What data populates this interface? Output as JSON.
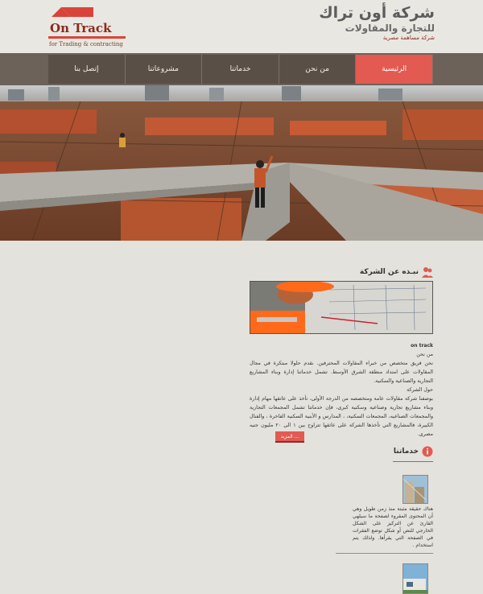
{
  "brand": {
    "logo_name": "On Track",
    "logo_tagline": "for Trading & contracting",
    "company_name": "شركة أون تراك",
    "company_sub": "للتجارة والمقاولات",
    "company_type": "شركة مساهمة مصرية",
    "colors": {
      "accent": "#e25a52",
      "nav_bg": "#5a4f47",
      "logo_red": "#8b2a1b"
    }
  },
  "nav": {
    "items": [
      {
        "label": "الرئيسية"
      },
      {
        "label": "من نحن"
      },
      {
        "label": "خدماتنا"
      },
      {
        "label": "مشروعاتنا"
      },
      {
        "label": "إتصل بنا"
      }
    ],
    "active_index": 0
  },
  "slider": {
    "slide_count": 4,
    "active_index": 1
  },
  "about": {
    "title": "نبـذه عن الشركة",
    "about_label_en": "on track",
    "about_label": "من نحن",
    "p1": "نحن فريق متخصص من خبراء المقاولات المحترفين. نقدم حلولا مبتكرة في مجال المقاولات على امتداد منطقة الشرق الأوسط. تشمل خدماتنا إدارة وبناء المشاريع التجارية والصناعية والسكنية.",
    "heading2": "حول الشركة",
    "p2": "بوصفنا شركة مقاولات عامة ومتخصصه من الدرجة الأولى، تأخذ على عاتقها مهام إدارة وبناء مشاريع تجارية وصناعية وسكنية كبرى، فإن خدماتنا تشمل المجمعات التجارية والمجمعات الصناعيه، المجمعات السكنية، ، المدارس و الأبنية السكنية الفاخرة ، والفنال الكبيرة، فالمشاريع التي تأخذها الشركة على عاتقها تتراوح بين ١ الى ٢٠ مليون جنيه مصرى.",
    "more_label": "المزيد ..."
  },
  "services": {
    "title": "خدماتنا",
    "item1_text": "هناك حقيقة مثبتة منذ زمن طويل وهي أن المحتوى المقروء لصفحة ما سيلهي القارئ عن التركيز على الشكل الخارجي للنص أو شكل توضع الفقرات في الصفحة التي يقرأها. ولذلك يتم استخدام ."
  }
}
